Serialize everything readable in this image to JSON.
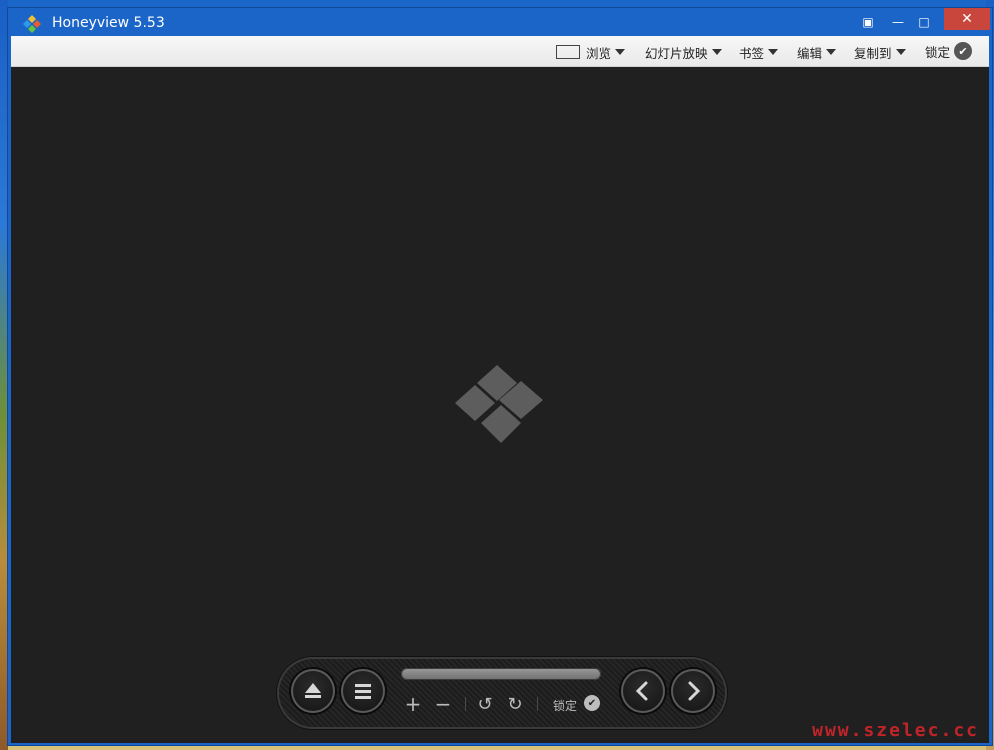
{
  "window": {
    "title": "Honeyview 5.53",
    "controls": {
      "capture": "▣",
      "minimize": "—",
      "maximize": "□",
      "close": "✕"
    }
  },
  "menubar": {
    "items": [
      {
        "label": "浏览",
        "icon": "fit-window-icon"
      },
      {
        "label": "幻灯片放映"
      },
      {
        "label": "书签"
      },
      {
        "label": "编辑"
      },
      {
        "label": "复制到"
      }
    ],
    "lock_label": "锁定",
    "lock_check": "✔"
  },
  "controls_bar": {
    "zoom_in": "+",
    "zoom_out": "−",
    "rotate_left": "↺",
    "rotate_right": "↻",
    "lock_label": "锁定",
    "lock_check": "✔",
    "icons": [
      "eject-icon",
      "menu-icon",
      "prev-icon",
      "next-icon"
    ]
  },
  "watermark": "www.szelec.cc",
  "colors": {
    "titlebar": "#1b65c8",
    "close": "#c9463d",
    "canvas": "#202020",
    "logo_gray": "#5d5d5d"
  }
}
